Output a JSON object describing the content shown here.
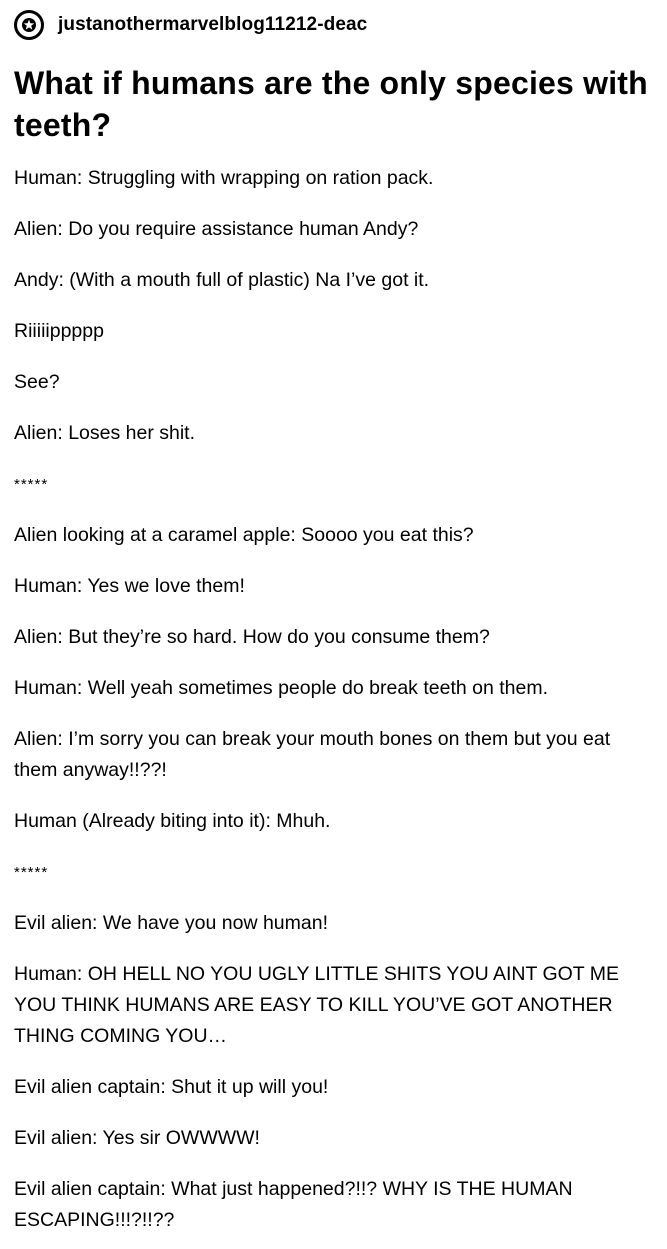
{
  "blog": {
    "name": "justanothermarvelblog11212-deac",
    "avatar_icon": "star-circle-icon"
  },
  "post": {
    "title": "What if humans are the only species with teeth?",
    "paragraphs": [
      "Human: Struggling with wrapping on ration pack.",
      "Alien: Do you require assistance human Andy?",
      "Andy: (With a mouth full of plastic) Na I’ve got it.",
      "Riiiiippppp",
      "See?",
      "Alien: Loses her shit.",
      "*****",
      "Alien looking at a caramel apple: Soooo you eat this?",
      "Human: Yes we love them!",
      "Alien: But they’re so hard. How do you consume them?",
      "Human: Well yeah sometimes people do break teeth on them.",
      "Alien: I’m sorry you can break your mouth bones on them but you eat them anyway!!??!",
      "Human (Already biting into it): Mhuh.",
      "*****",
      "Evil alien: We have you now human!",
      "Human: OH HELL NO YOU UGLY LITTLE SHITS YOU AINT GOT ME YOU THINK HUMANS ARE EASY TO KILL YOU’VE GOT ANOTHER THING COMING YOU…",
      "Evil alien captain: Shut it up will you!",
      "Evil alien: Yes sir OWWWW!",
      "Evil alien captain: What just happened?!!? WHY IS THE HUMAN ESCAPING!!!?!!??"
    ]
  }
}
